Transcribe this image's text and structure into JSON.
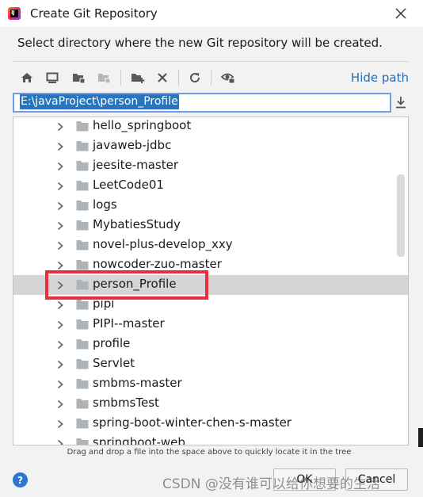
{
  "window": {
    "title": "Create Git Repository",
    "subtitle": "Select directory where the new Git repository will be created."
  },
  "toolbar": {
    "icons": [
      "home-icon",
      "desktop-icon",
      "project-folder-icon",
      "module-folder-icon",
      "new-folder-icon",
      "delete-icon",
      "refresh-icon",
      "show-hidden-icon"
    ],
    "hide_path_label": "Hide path"
  },
  "path": {
    "value": "E:\\javaProject\\person_Profile"
  },
  "tree": {
    "items": [
      {
        "label": "hello_springboot"
      },
      {
        "label": "javaweb-jdbc"
      },
      {
        "label": "jeesite-master"
      },
      {
        "label": "LeetCode01"
      },
      {
        "label": "logs"
      },
      {
        "label": "MybatiesStudy"
      },
      {
        "label": "novel-plus-develop_xxy"
      },
      {
        "label": "nowcoder-zuo-master"
      },
      {
        "label": "person_Profile",
        "selected": true
      },
      {
        "label": "pipi"
      },
      {
        "label": "PIPI--master"
      },
      {
        "label": "profile"
      },
      {
        "label": "Servlet"
      },
      {
        "label": "smbms-master"
      },
      {
        "label": "smbmsTest"
      },
      {
        "label": "spring-boot-winter-chen-s-master"
      },
      {
        "label": "springboot-web"
      }
    ]
  },
  "hint": "Drag and drop a file into the space above to quickly locate it in the tree",
  "footer": {
    "help_label": "?",
    "ok_label": "OK",
    "cancel_label": "Cancel"
  },
  "watermark": "CSDN @没有谁可以给你想要的生活",
  "colors": {
    "accent": "#2675bf",
    "link": "#2470b3",
    "highlight": "#e8303a",
    "selected_row": "#d5d5d5"
  }
}
